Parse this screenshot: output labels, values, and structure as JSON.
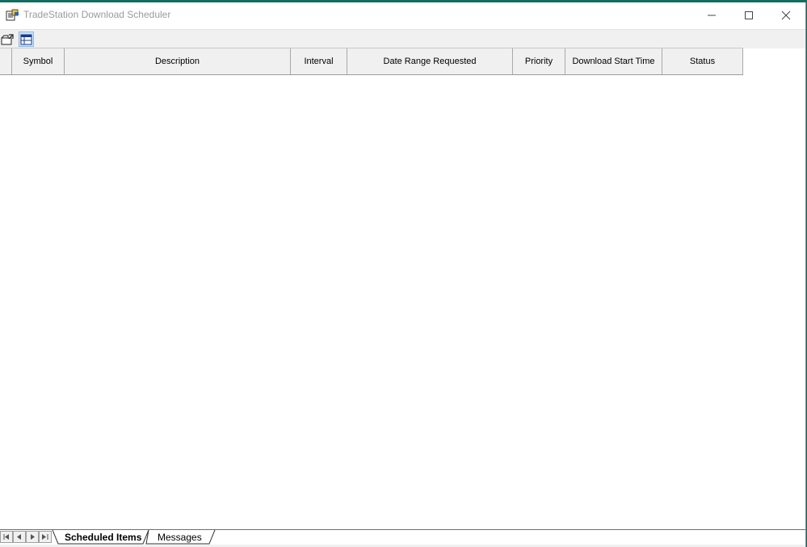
{
  "window": {
    "title": "TradeStation Download Scheduler"
  },
  "toolbar": {
    "buttons": [
      {
        "icon": "open-folder-icon"
      },
      {
        "icon": "schedule-view-icon",
        "active": true
      }
    ]
  },
  "grid": {
    "columns": [
      {
        "label": ""
      },
      {
        "label": "Symbol"
      },
      {
        "label": "Description"
      },
      {
        "label": "Interval"
      },
      {
        "label": "Date Range Requested"
      },
      {
        "label": "Priority"
      },
      {
        "label": "Download Start Time"
      },
      {
        "label": "Status"
      }
    ],
    "rows": []
  },
  "tabs": {
    "items": [
      {
        "label": "Scheduled Items",
        "active": true
      },
      {
        "label": "Messages",
        "active": false
      }
    ]
  },
  "colors": {
    "desktop": "#0f6e5e",
    "header_bg": "#f0f0f0",
    "active_tool": "#cce4f7"
  }
}
